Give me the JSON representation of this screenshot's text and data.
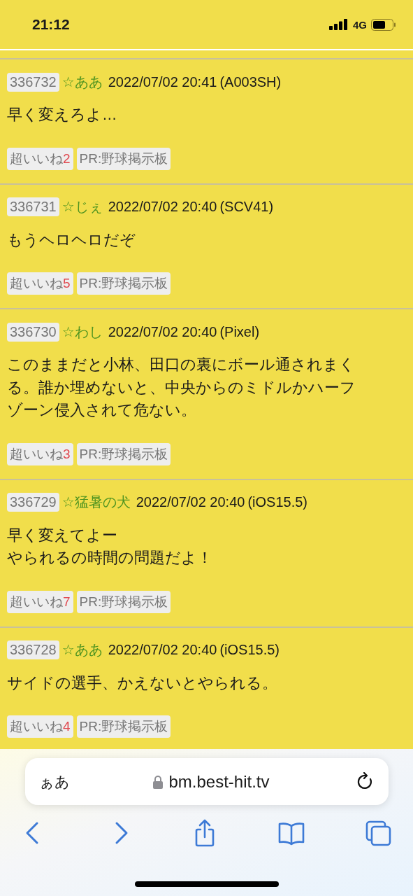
{
  "status_bar": {
    "time": "21:12",
    "network": "4G"
  },
  "posts": [
    {
      "number": "336732",
      "name": "☆ああ",
      "date": "2022/07/02 20:41",
      "device": "(A003SH)",
      "lines": [
        "早く変えろよ…"
      ],
      "like_label": "超いいね",
      "like_count": "2",
      "pr": "PR:野球掲示板"
    },
    {
      "number": "336731",
      "name": "☆じぇ",
      "date": "2022/07/02 20:40",
      "device": "(SCV41)",
      "lines": [
        "もうヘロヘロだぞ"
      ],
      "like_label": "超いいね",
      "like_count": "5",
      "pr": "PR:野球掲示板"
    },
    {
      "number": "336730",
      "name": "☆わし",
      "date": "2022/07/02 20:40",
      "device": "(Pixel)",
      "lines": [
        "このままだと小林、田口の裏にボール通されまく",
        "る。誰か埋めないと、中央からのミドルかハーフ",
        "ゾーン侵入されて危ない。"
      ],
      "like_label": "超いいね",
      "like_count": "3",
      "pr": "PR:野球掲示板"
    },
    {
      "number": "336729",
      "name": "☆猛暑の犬",
      "date": "2022/07/02 20:40",
      "device": "(iOS15.5)",
      "lines": [
        "早く変えてよー",
        "やられるの時間の問題だよ！"
      ],
      "like_label": "超いいね",
      "like_count": "7",
      "pr": "PR:野球掲示板"
    },
    {
      "number": "336728",
      "name": "☆ああ",
      "date": "2022/07/02 20:40",
      "device": "(iOS15.5)",
      "lines": [
        "サイドの選手、かえないとやられる。"
      ],
      "like_label": "超いいね",
      "like_count": "4",
      "pr": "PR:野球掲示板"
    }
  ],
  "browser": {
    "text_size_label": "ぁあ",
    "url": "bm.best-hit.tv"
  }
}
